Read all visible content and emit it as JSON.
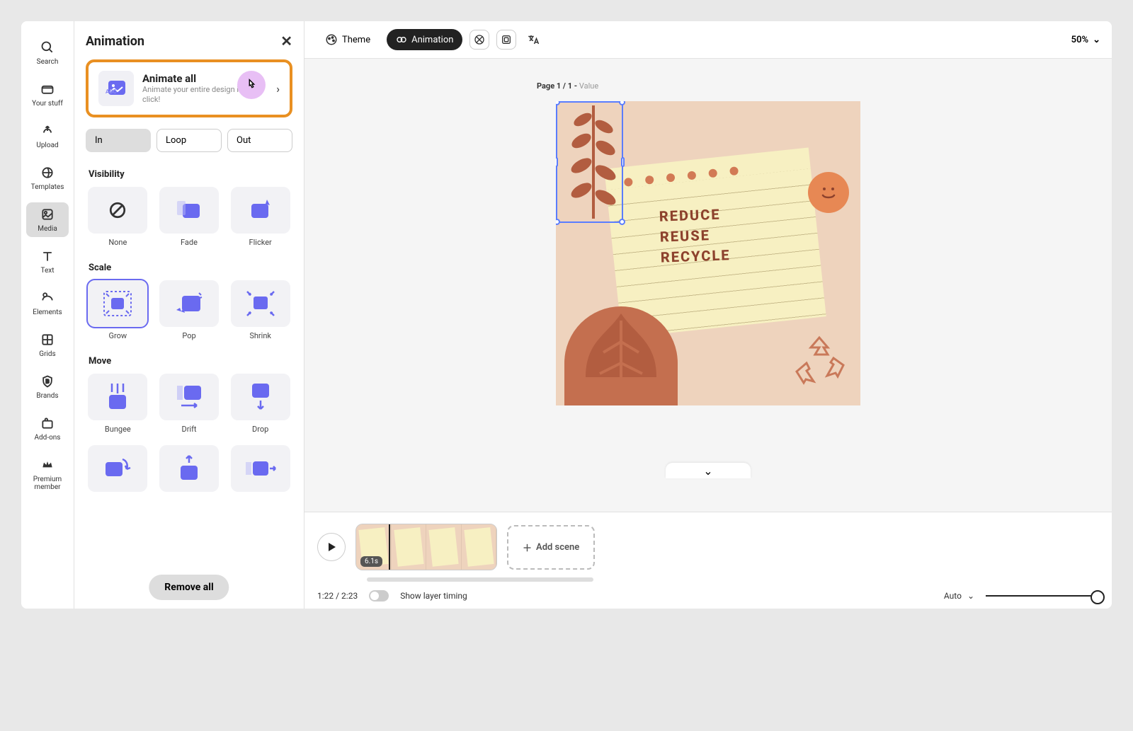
{
  "leftRail": {
    "items": [
      {
        "label": "Search"
      },
      {
        "label": "Your stuff"
      },
      {
        "label": "Upload"
      },
      {
        "label": "Templates"
      },
      {
        "label": "Media"
      },
      {
        "label": "Text"
      },
      {
        "label": "Elements"
      },
      {
        "label": "Grids"
      },
      {
        "label": "Brands"
      },
      {
        "label": "Add-ons"
      },
      {
        "label": "Premium member"
      }
    ]
  },
  "panel": {
    "title": "Animation",
    "animateAll": {
      "title": "Animate all",
      "subtitle": "Animate your entire design in one click!"
    },
    "tabs": {
      "in": "In",
      "loop": "Loop",
      "out": "Out"
    },
    "sections": {
      "visibility": "Visibility",
      "scale": "Scale",
      "move": "Move"
    },
    "presets": {
      "visibility": [
        {
          "label": "None"
        },
        {
          "label": "Fade"
        },
        {
          "label": "Flicker"
        }
      ],
      "scale": [
        {
          "label": "Grow"
        },
        {
          "label": "Pop"
        },
        {
          "label": "Shrink"
        }
      ],
      "move": [
        {
          "label": "Bungee"
        },
        {
          "label": "Drift"
        },
        {
          "label": "Drop"
        }
      ]
    },
    "removeAll": "Remove all"
  },
  "toolbar": {
    "theme": "Theme",
    "animation": "Animation",
    "zoom": "50%"
  },
  "canvas": {
    "pageLabel": "Page 1 / 1 -",
    "pageValue": "Value",
    "artText1": "REDUCE",
    "artText2": "REUSE",
    "artText3": "RECYCLE"
  },
  "timeline": {
    "duration": "6.1s",
    "addScene": "Add scene",
    "time": "1:22 / 2:23",
    "showLayerTiming": "Show layer timing",
    "auto": "Auto"
  }
}
